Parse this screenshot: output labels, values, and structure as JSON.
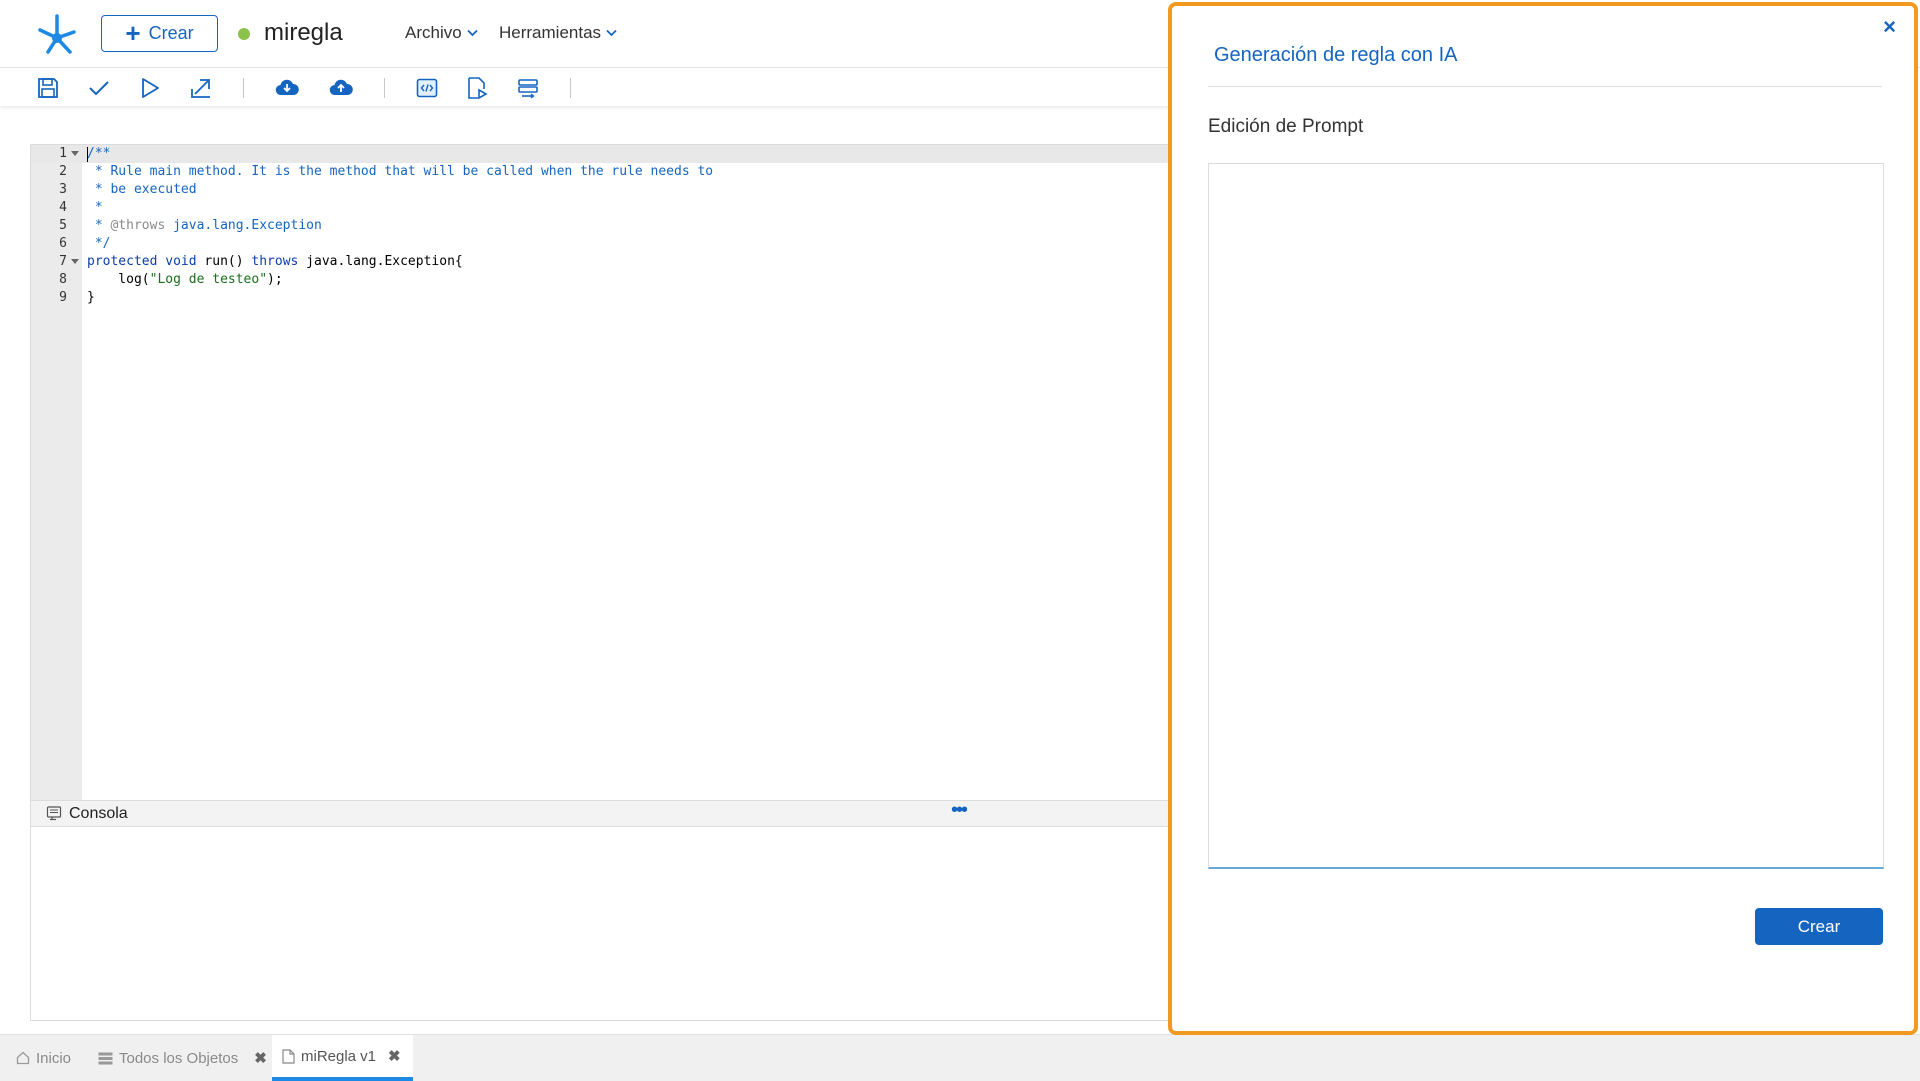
{
  "header": {
    "create_label": "Crear",
    "rule_name": "miregla",
    "status_color": "#8bc34a",
    "menus": [
      {
        "label": "Archivo",
        "icon": "chevron-down-icon"
      },
      {
        "label": "Herramientas",
        "icon": "chevron-down-icon"
      }
    ]
  },
  "toolbar": {
    "icons": [
      "save-icon",
      "check-icon",
      "play-icon",
      "export-icon",
      "cloud-download-icon",
      "cloud-upload-icon",
      "code-view-icon",
      "document-run-icon",
      "list-icon"
    ]
  },
  "editor": {
    "line_numbers": [
      "1",
      "2",
      "3",
      "4",
      "5",
      "6",
      "7",
      "8",
      "9"
    ],
    "lines": {
      "l1": "/**",
      "l2": " * Rule main method. It is the method that will be called when the rule needs to",
      "l3": " * be executed",
      "l4": " *",
      "l5_star": " * ",
      "l5_tag": "@throws",
      "l5_rest": " java.lang.Exception",
      "l6": " */",
      "l7_kw1": "protected",
      "l7_kw2": "void",
      "l7_mid": " run() ",
      "l7_kw3": "throws",
      "l7_rest": " java.lang.Exception{",
      "l8_pre": "    log(",
      "l8_str": "\"Log de testeo\"",
      "l8_post": ");",
      "l9": "}"
    }
  },
  "console": {
    "title": "Consola",
    "more": "•••"
  },
  "tabs": [
    {
      "label": "Inicio",
      "icon": "home-icon"
    },
    {
      "label": "Todos los Objetos",
      "icon": "list-icon",
      "close": "✖"
    },
    {
      "label": "miRegla v1",
      "icon": "document-icon",
      "close": "✖"
    }
  ],
  "panel": {
    "close": "×",
    "title": "Generación de regla con IA",
    "subtitle": "Edición de Prompt",
    "prompt_value": "",
    "create_label": "Crear",
    "border_color": "#f29a1f",
    "accent_color": "#1565c0"
  }
}
